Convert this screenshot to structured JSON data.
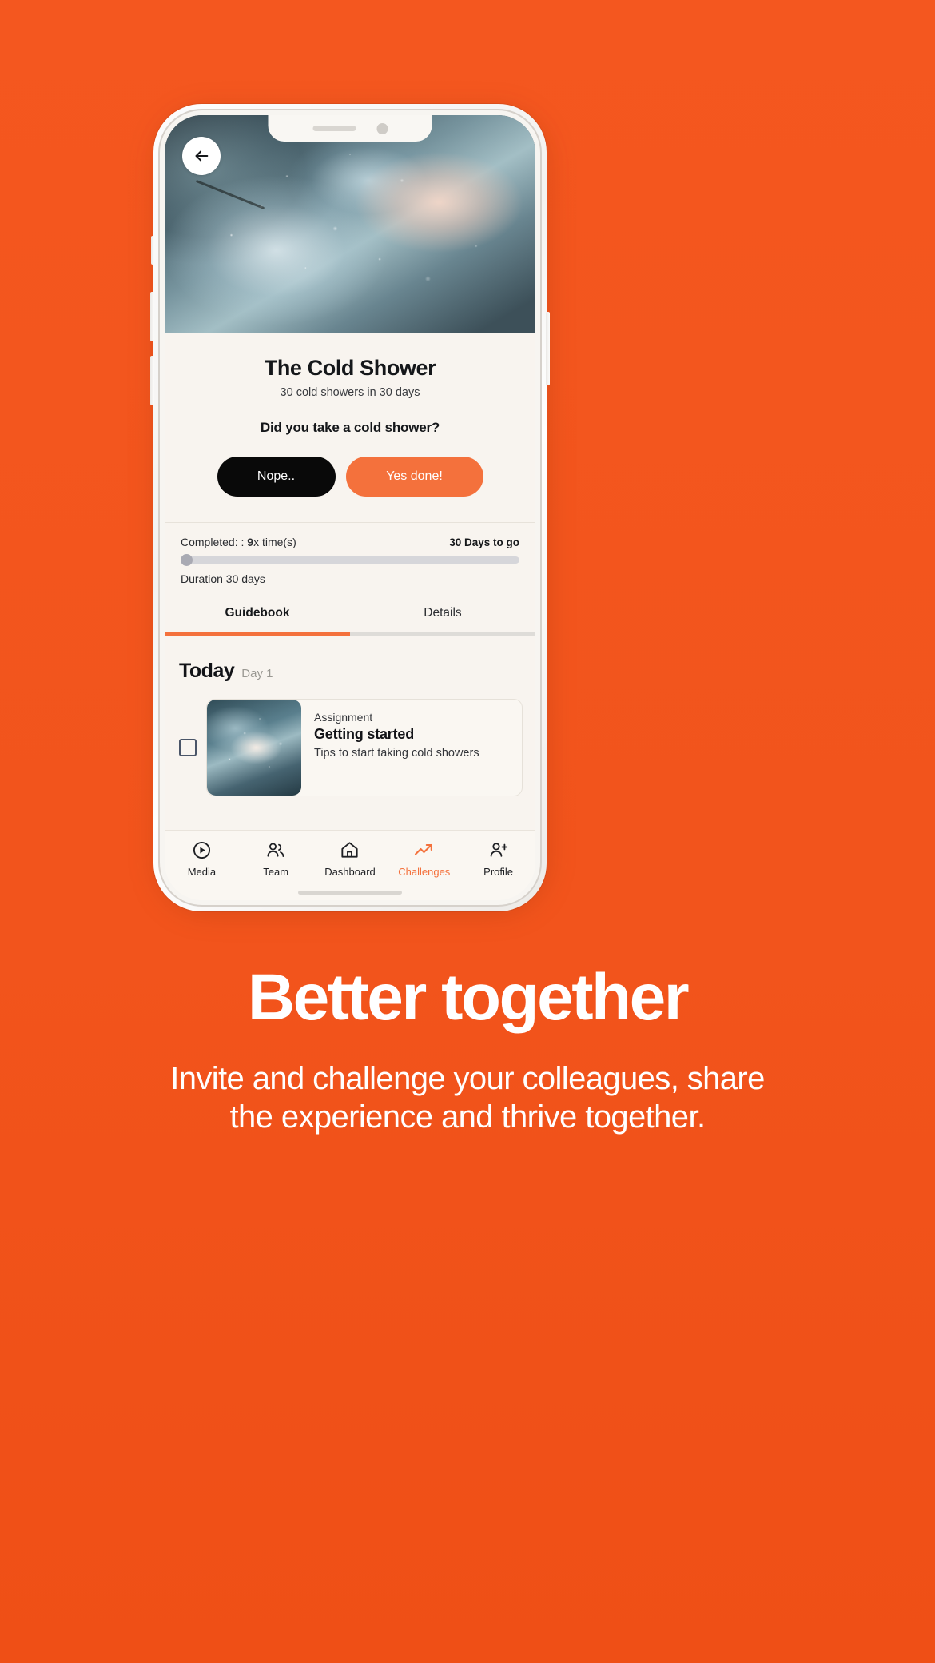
{
  "theme": {
    "background": "#F4551E",
    "accent": "#F4713C",
    "screen_bg": "#F8F4EF",
    "dark": "#090909",
    "text": "#15171A"
  },
  "phone": {
    "back_icon": "arrow-left-icon",
    "hero_image_alt": "cold-water-splash-photo"
  },
  "challenge": {
    "title": "The Cold Shower",
    "subtitle": "30 cold showers in 30 days",
    "question": "Did you take a cold shower?",
    "decline_label": "Nope..",
    "confirm_label": "Yes done!"
  },
  "progress": {
    "completed_label": "Completed: : ",
    "completed_count": "9",
    "completed_suffix": "x time(s)",
    "days_to_go": "30 Days to go",
    "duration": "Duration 30 days",
    "percent": 0
  },
  "tabs": [
    {
      "label": "Guidebook",
      "active": true
    },
    {
      "label": "Details",
      "active": false
    }
  ],
  "today": {
    "heading": "Today",
    "day": "Day 1"
  },
  "assignment": {
    "kicker": "Assignment",
    "title": "Getting started",
    "description": "Tips to start taking cold showers",
    "checked": false,
    "thumb_alt": "person-in-cold-water-photo"
  },
  "bottom_nav": [
    {
      "label": "Media",
      "icon": "play-circle-icon",
      "active": false
    },
    {
      "label": "Team",
      "icon": "people-icon",
      "active": false
    },
    {
      "label": "Dashboard",
      "icon": "home-icon",
      "active": false
    },
    {
      "label": "Challenges",
      "icon": "trending-up-icon",
      "active": true
    },
    {
      "label": "Profile",
      "icon": "person-add-icon",
      "active": false
    }
  ],
  "marketing": {
    "headline": "Better together",
    "subcopy": "Invite and challenge your colleagues, share the experience and thrive together."
  }
}
